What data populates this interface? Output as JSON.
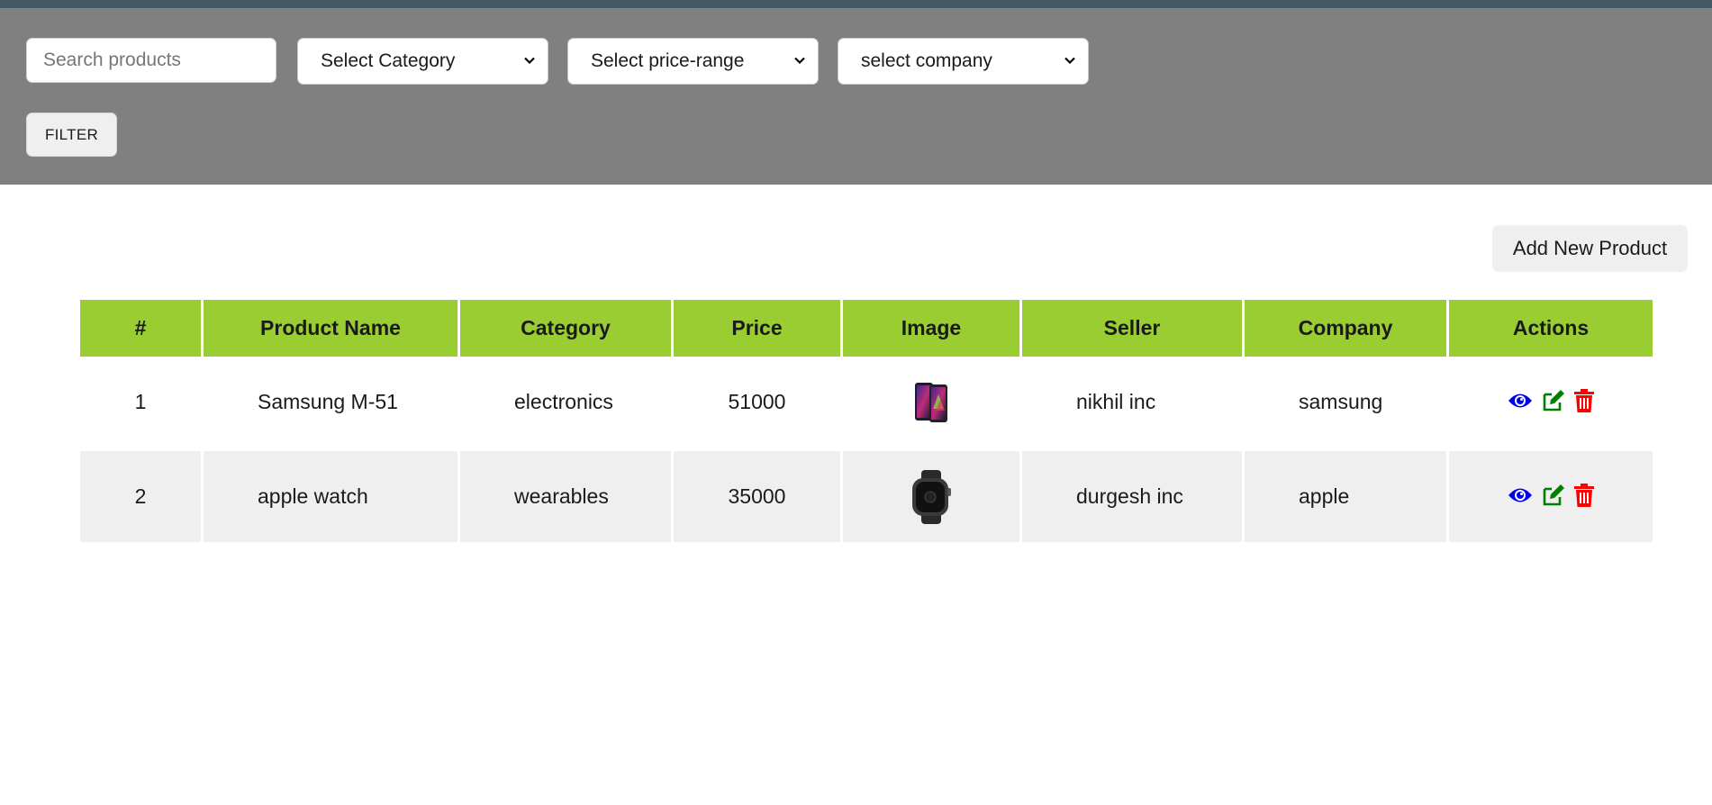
{
  "filters": {
    "search_placeholder": "Search products",
    "category_selected": "Select Category",
    "price_selected": "Select price-range",
    "company_selected": "select company",
    "filter_label": "FILTER"
  },
  "toolbar": {
    "add_label": "Add New Product"
  },
  "table": {
    "headers": [
      "#",
      "Product Name",
      "Category",
      "Price",
      "Image",
      "Seller",
      "Company",
      "Actions"
    ],
    "rows": [
      {
        "num": "1",
        "name": "Samsung M-51",
        "category": "electronics",
        "price": "51000",
        "image": "phone-image",
        "seller": "nikhil inc",
        "company": "samsung"
      },
      {
        "num": "2",
        "name": "apple watch",
        "category": "wearables",
        "price": "35000",
        "image": "watch-image",
        "seller": "durgesh inc",
        "company": "apple"
      }
    ]
  },
  "colors": {
    "header_green": "#9acd32",
    "filter_bar": "#808080",
    "view_icon": "#0000ee",
    "edit_icon": "#008000",
    "delete_icon": "#ff0000"
  },
  "icons": [
    "eye-icon",
    "edit-icon",
    "trash-icon",
    "chevron-down-icon"
  ]
}
